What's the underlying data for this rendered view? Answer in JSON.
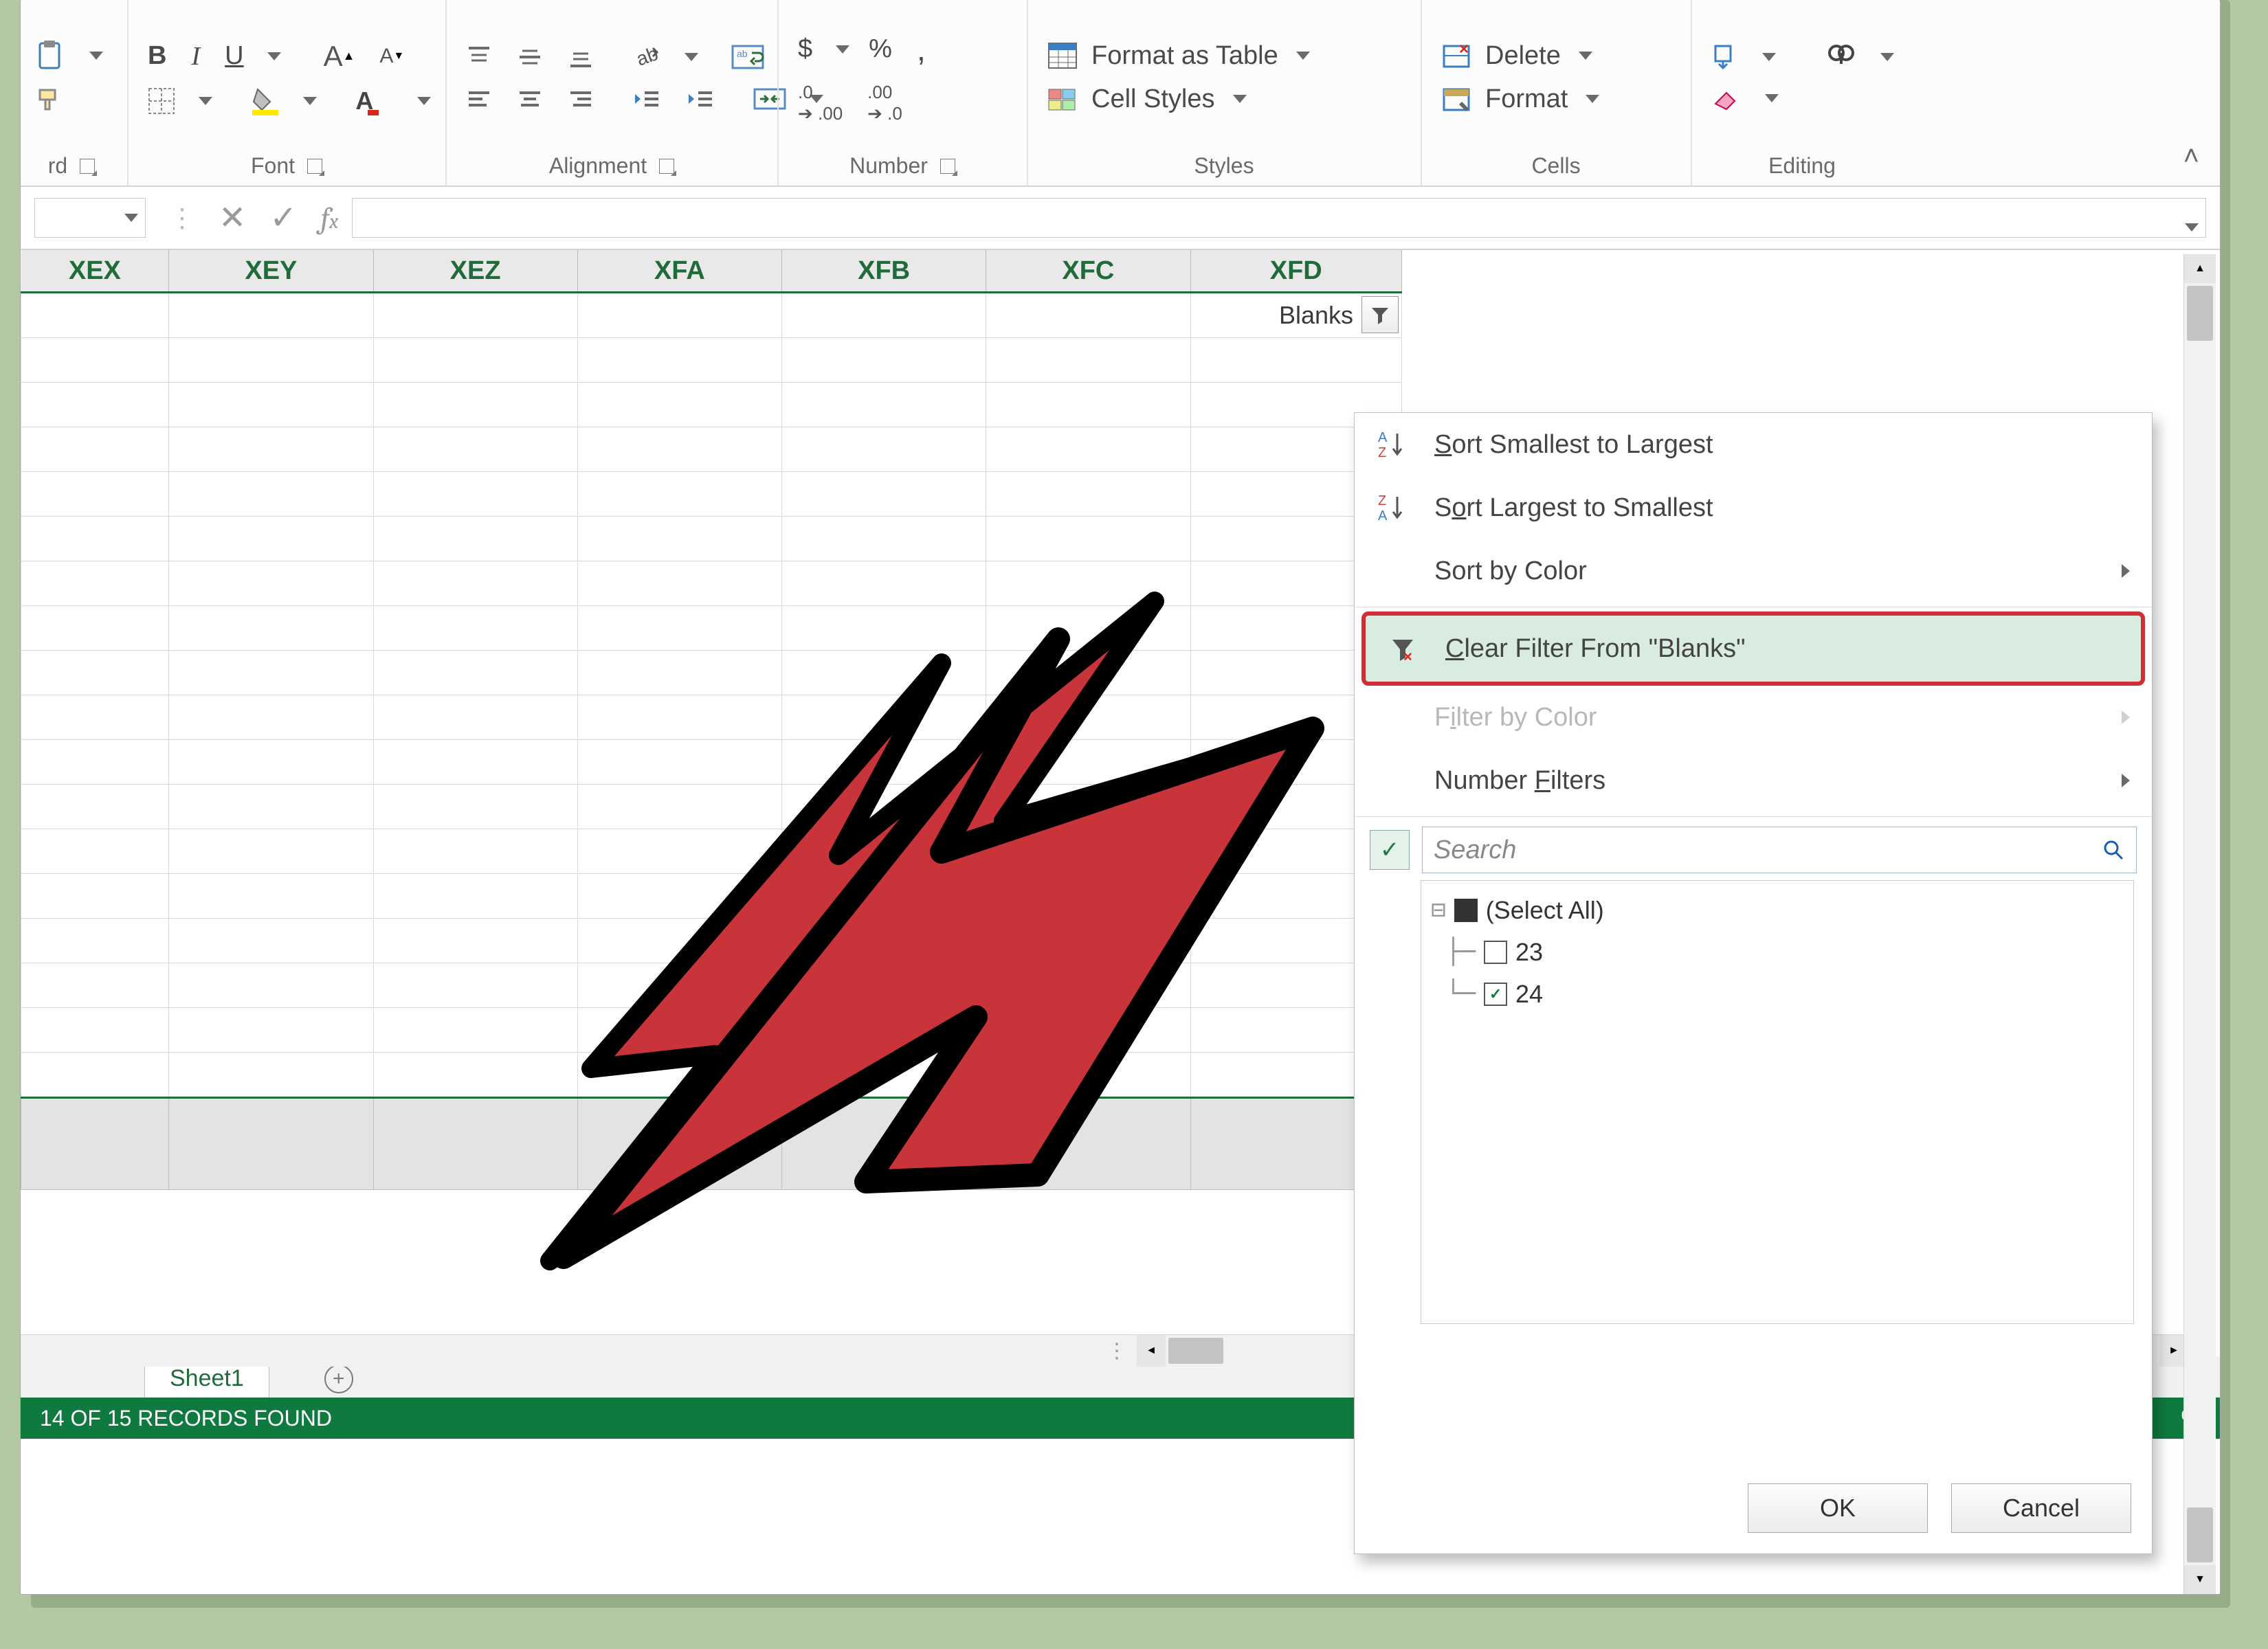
{
  "ribbon": {
    "clipboard": {
      "caption": "rd"
    },
    "font": {
      "caption": "Font",
      "bold": "B",
      "italic": "I",
      "underline": "U"
    },
    "alignment": {
      "caption": "Alignment"
    },
    "number": {
      "caption": "Number",
      "currency": "$",
      "percent": "%",
      "comma": ",",
      "inc": ".0  .00",
      "dec": ".00  .0"
    },
    "styles": {
      "caption": "Styles",
      "format_table": "Format as Table",
      "cell_styles": "Cell Styles"
    },
    "cells": {
      "caption": "Cells",
      "delete": "Delete",
      "format": "Format"
    },
    "editing": {
      "caption": "Editing"
    }
  },
  "columns": [
    "XEX",
    "XEY",
    "XEZ",
    "XFA",
    "XFB",
    "XFC",
    "XFD"
  ],
  "filter_cell": {
    "label": "Blanks"
  },
  "sheet_tab": "Sheet1",
  "status": {
    "left": "14 OF 15 RECORDS FOUND",
    "right": "%"
  },
  "filter_menu": {
    "sort_asc": "Sort Smallest to Largest",
    "sort_desc": "Sort Largest to Smallest",
    "sort_color": "Sort by Color",
    "clear": "Clear Filter From \"Blanks\"",
    "filter_color": "Filter by Color",
    "number_filters": "Number Filters",
    "search_placeholder": "Search",
    "select_all": "(Select All)",
    "item_23": "23",
    "item_24": "24",
    "ok": "OK",
    "cancel": "Cancel"
  }
}
